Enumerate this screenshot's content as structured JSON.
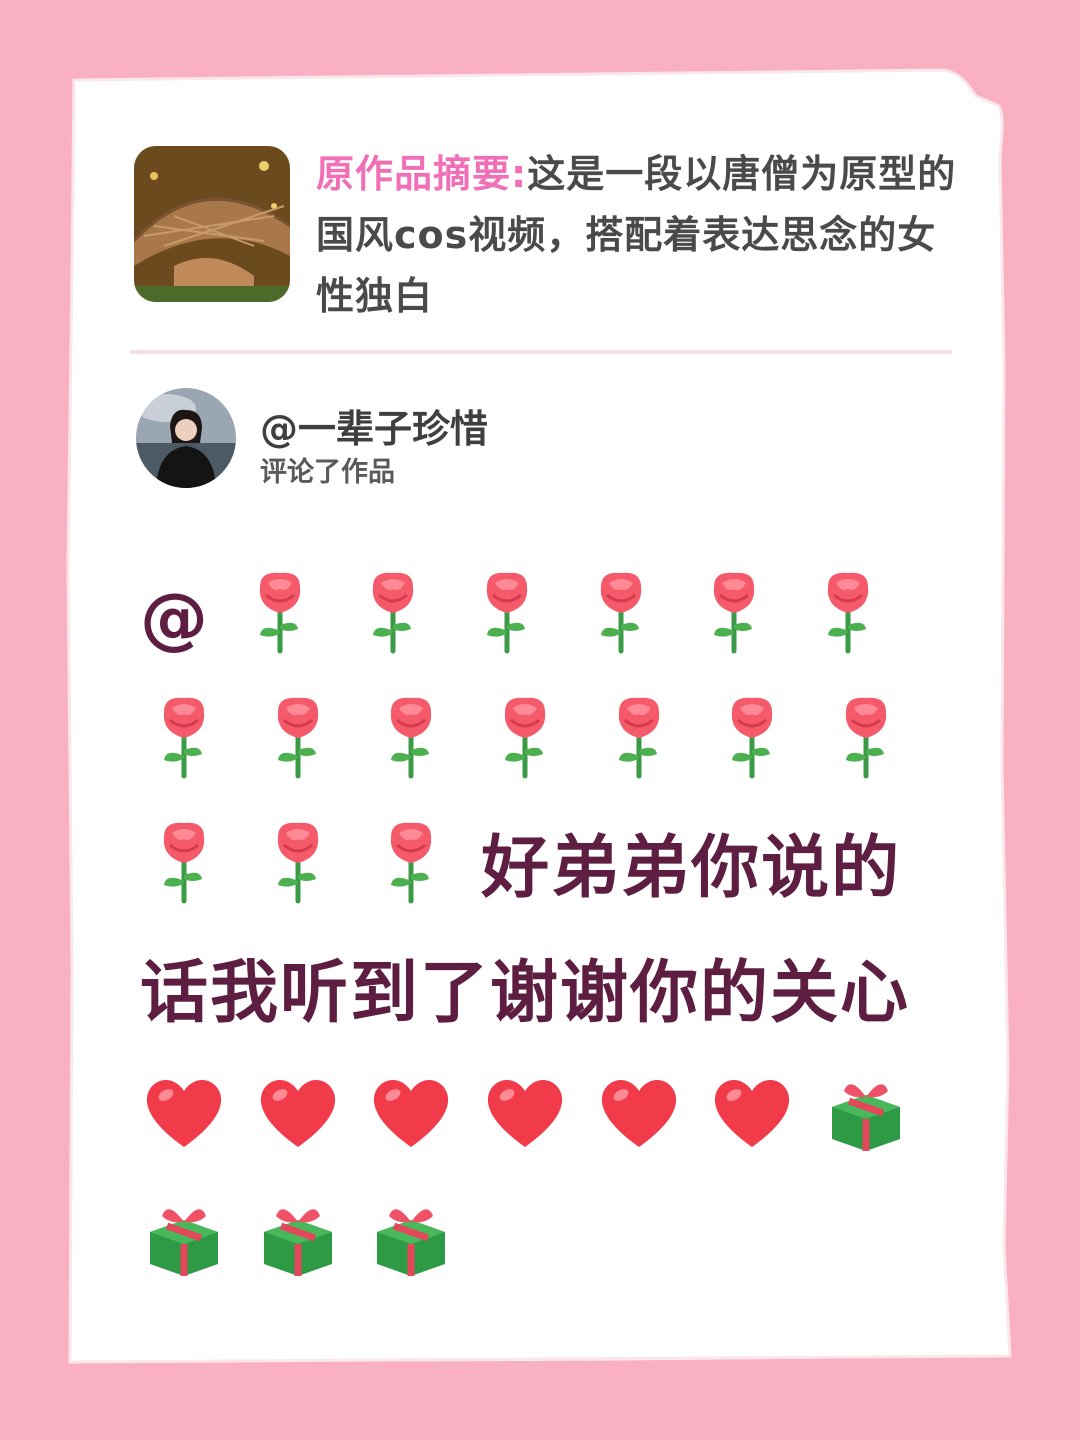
{
  "summary": {
    "label": "原作品摘要:",
    "text": "这是一段以唐僧为原型的国风cos视频，搭配着表达思念的女性独白"
  },
  "commenter": {
    "name": "@一辈子珍惜",
    "action": "评论了作品"
  },
  "comment": {
    "prefix": "@",
    "rose_count_before_text": 16,
    "text": "好弟弟你说的话我听到了谢谢你的关心",
    "heart_count": 6,
    "gift_count": 4
  },
  "colors": {
    "background": "#f9b0c3",
    "summary_label": "#f06fb6",
    "comment_text": "#5e1e42"
  },
  "icons": [
    "rose-emoji",
    "heart-emoji",
    "gift-emoji"
  ]
}
